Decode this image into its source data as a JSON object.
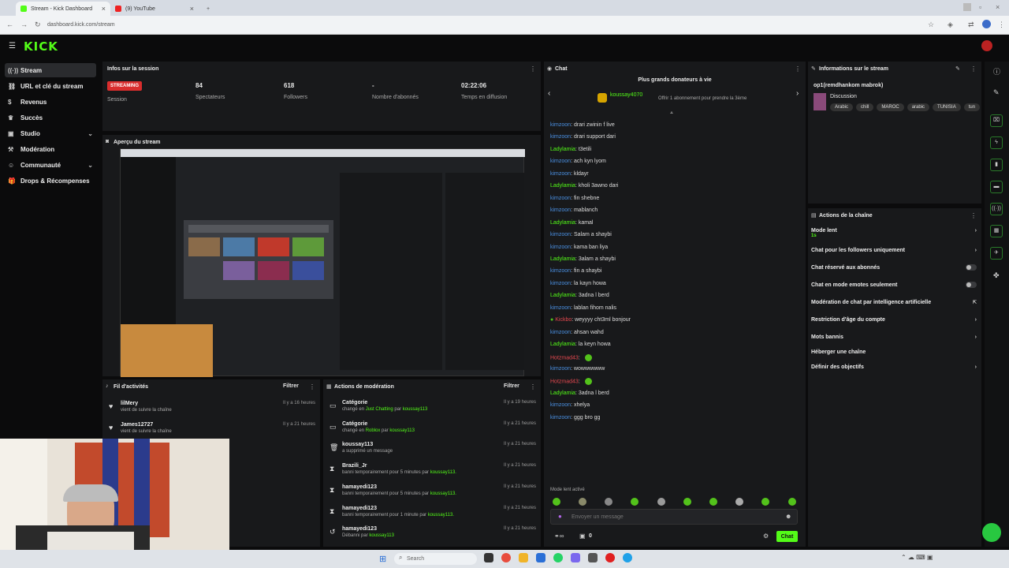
{
  "browser": {
    "tabs": [
      {
        "label": "Stream - Kick Dashboard"
      },
      {
        "label": "(9) YouTube"
      }
    ],
    "url": "dashboard.kick.com/stream"
  },
  "app": {
    "logo": "KICK"
  },
  "sidebar": {
    "items": [
      {
        "label": "Stream",
        "icon": "broadcast-icon"
      },
      {
        "label": "URL et clé du stream",
        "icon": "link-icon"
      },
      {
        "label": "Revenus",
        "icon": "dollar-icon"
      },
      {
        "label": "Succès",
        "icon": "trophy-icon"
      },
      {
        "label": "Studio",
        "icon": "studio-icon"
      },
      {
        "label": "Modération",
        "icon": "hammer-icon"
      },
      {
        "label": "Communauté",
        "icon": "community-icon"
      },
      {
        "label": "Drops & Récompenses",
        "icon": "gift-icon"
      }
    ]
  },
  "session": {
    "title": "Infos sur la session",
    "badge": "STREAMING",
    "badge_label": "Session",
    "stats": [
      {
        "value": "84",
        "label": "Spectateurs"
      },
      {
        "value": "618",
        "label": "Followers"
      },
      {
        "value": "-",
        "label": "Nombre d'abonnés"
      },
      {
        "value": "02:22:06",
        "label": "Temps en diffusion"
      }
    ]
  },
  "preview": {
    "title": "Aperçu du stream"
  },
  "activity": {
    "title": "Fil d'activités",
    "filter": "Filtrer",
    "items": [
      {
        "user": "lilMery",
        "text": "vient de suivre la chaîne",
        "time": "Il y a 16 heures"
      },
      {
        "user": "James12727",
        "text": "vient de suivre la chaîne",
        "time": "Il y a 21 heures"
      }
    ]
  },
  "moderation": {
    "title": "Actions de modération",
    "filter": "Filtrer",
    "items": [
      {
        "title": "Catégorie",
        "pre": "changé en ",
        "hl": "Just Chatting",
        "mid": " par ",
        "user": "koussay113",
        "time": "Il y a 19 heures"
      },
      {
        "title": "Catégorie",
        "pre": "changé en ",
        "hl": "Roblox",
        "mid": " par ",
        "user": "koussay113",
        "time": "Il y a 21 heures"
      },
      {
        "title": "koussay113",
        "pre": "a supprimé un message",
        "hl": "",
        "mid": "",
        "user": "",
        "time": "Il y a 21 heures"
      },
      {
        "title": "Brazili_Jr",
        "pre": "banni temporairement pour 5 minutes par ",
        "hl": "",
        "mid": "",
        "user": "koussay113.",
        "time": "Il y a 21 heures"
      },
      {
        "title": "hamayedi123",
        "pre": "banni temporairement pour 5 minutes par ",
        "hl": "",
        "mid": "",
        "user": "koussay113.",
        "time": "Il y a 21 heures"
      },
      {
        "title": "hamayedi123",
        "pre": "banni temporairement pour 1 minute par ",
        "hl": "",
        "mid": "",
        "user": "koussay113.",
        "time": "Il y a 21 heures"
      },
      {
        "title": "hamayedi123",
        "pre": "Débanni par ",
        "hl": "",
        "mid": "",
        "user": "koussay113",
        "time": "Il y a 21 heures"
      }
    ]
  },
  "chat": {
    "title": "Chat",
    "donors_title": "Plus grands donateurs à vie",
    "donor_name": "koussay4070",
    "donor_offer": "Offrir 1 abonnement pour prendre la 3ème",
    "messages": [
      {
        "user": "kimzoon",
        "color": "#4a90e2",
        "text": "drari zwinin f live"
      },
      {
        "user": "kimzoon",
        "color": "#4a90e2",
        "text": "drari support dari"
      },
      {
        "user": "Ladylamia",
        "color": "#53fc18",
        "text": "t3etili"
      },
      {
        "user": "kimzoon",
        "color": "#4a90e2",
        "text": "ach kyn lyom"
      },
      {
        "user": "kimzoon",
        "color": "#4a90e2",
        "text": "kldayr"
      },
      {
        "user": "Ladylamia",
        "color": "#53fc18",
        "text": "kholi 3awno dari"
      },
      {
        "user": "kimzoon",
        "color": "#4a90e2",
        "text": "fin shebne"
      },
      {
        "user": "kimzoon",
        "color": "#4a90e2",
        "text": "mablanch"
      },
      {
        "user": "Ladylamia",
        "color": "#53fc18",
        "text": "kamal"
      },
      {
        "user": "kimzoon",
        "color": "#4a90e2",
        "text": "Salam a shaybi"
      },
      {
        "user": "kimzoon",
        "color": "#4a90e2",
        "text": "kama ban liya"
      },
      {
        "user": "Ladylamia",
        "color": "#53fc18",
        "text": "3alam a shaybi"
      },
      {
        "user": "kimzoon",
        "color": "#4a90e2",
        "text": "fin a shaybi"
      },
      {
        "user": "kimzoon",
        "color": "#4a90e2",
        "text": "la kayn howa"
      },
      {
        "user": "Ladylamia",
        "color": "#53fc18",
        "text": "3adna l berd"
      },
      {
        "user": "kimzoon",
        "color": "#4a90e2",
        "text": "lablan fihom nalis"
      },
      {
        "user": "Kickbo",
        "color": "#e4484f",
        "text": "weyyyy cht3ml bonjour"
      },
      {
        "user": "kimzoon",
        "color": "#4a90e2",
        "text": "ahsan wahd"
      },
      {
        "user": "Ladylamia",
        "color": "#53fc18",
        "text": "la keyn howa"
      },
      {
        "user": "Hotzmad43",
        "color": "#e4484f",
        "text": ""
      },
      {
        "user": "kimzoon",
        "color": "#4a90e2",
        "text": "wowwwwww"
      },
      {
        "user": "Hotzmad43",
        "color": "#e4484f",
        "text": ""
      },
      {
        "user": "Ladylamia",
        "color": "#53fc18",
        "text": "3adna l berd"
      },
      {
        "user": "kimzoon",
        "color": "#4a90e2",
        "text": "xhelya"
      },
      {
        "user": "kimzoon",
        "color": "#4a90e2",
        "text": "ggg bro gg"
      }
    ],
    "slow_mode": "Mode lent activé",
    "placeholder": "Envoyer un message",
    "count": "0",
    "send": "Chat"
  },
  "stream_info": {
    "title": "Informations sur le stream",
    "stream_title": "op1(remdhankom mabrok)",
    "category": "Discussion",
    "tags": [
      "Arabic",
      "chill",
      "MAROC",
      "arabic",
      "TUNISIA",
      "tun"
    ]
  },
  "channel_actions": {
    "title": "Actions de la chaîne",
    "items": [
      {
        "label": "Mode lent",
        "sub": "1s",
        "ctl": "chevron"
      },
      {
        "label": "Chat pour les followers uniquement",
        "sub": "",
        "ctl": "chevron"
      },
      {
        "label": "Chat réservé aux abonnés",
        "sub": "",
        "ctl": "toggle"
      },
      {
        "label": "Chat en mode emotes seulement",
        "sub": "",
        "ctl": "toggle"
      },
      {
        "label": "Modération de chat par intelligence artificielle",
        "sub": "",
        "ctl": "external"
      },
      {
        "label": "Restriction d'âge du compte",
        "sub": "",
        "ctl": "chevron"
      },
      {
        "label": "Mots bannis",
        "sub": "",
        "ctl": "chevron"
      },
      {
        "label": "Héberger une chaîne",
        "sub": "",
        "ctl": ""
      },
      {
        "label": "Définir des objectifs",
        "sub": "",
        "ctl": "chevron"
      }
    ]
  },
  "taskbar": {
    "search": "Search"
  },
  "colors": {
    "accent": "#53fc18",
    "live_red": "#e4484f",
    "panel": "#18191b",
    "bg": "#0b0b0c"
  }
}
